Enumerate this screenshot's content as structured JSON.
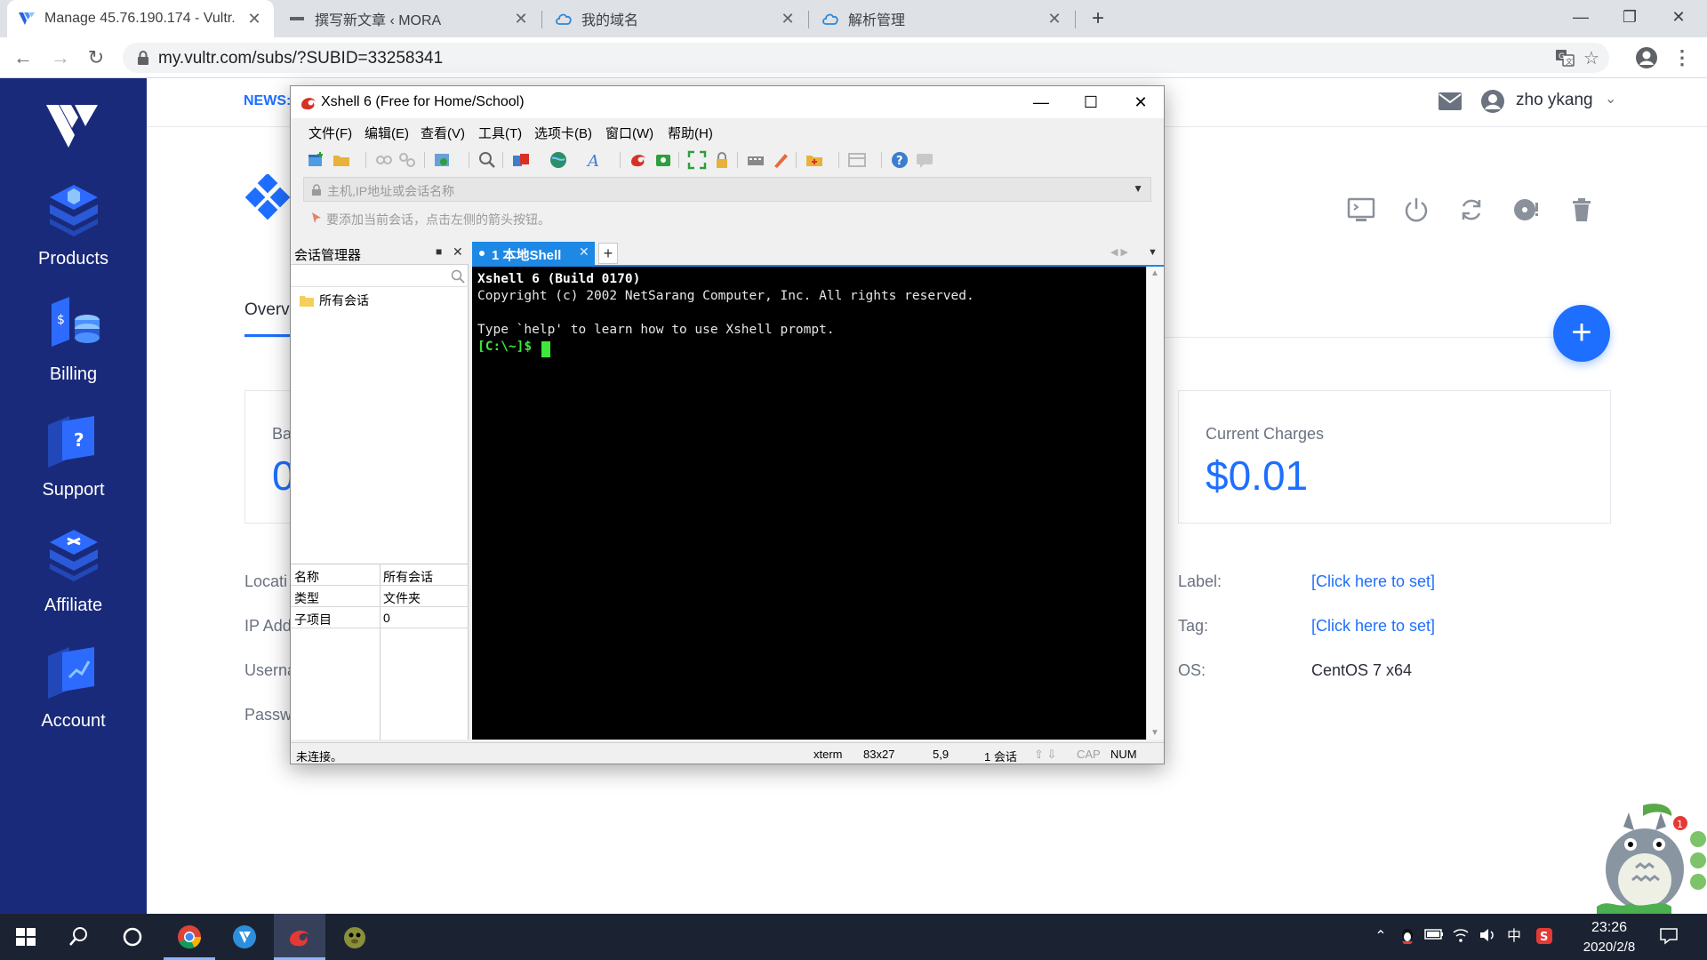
{
  "browser": {
    "tabs": [
      {
        "title": "Manage 45.76.190.174 - Vultr.",
        "active": true
      },
      {
        "title": "撰写新文章 ‹ MORA",
        "active": false
      },
      {
        "title": "我的域名",
        "active": false
      },
      {
        "title": "解析管理",
        "active": false
      }
    ],
    "url": "my.vultr.com/subs/?SUBID=33258341"
  },
  "sidebar": {
    "items": [
      {
        "label": "Products",
        "icon": "products-icon"
      },
      {
        "label": "Billing",
        "icon": "billing-icon"
      },
      {
        "label": "Support",
        "icon": "support-icon"
      },
      {
        "label": "Affiliate",
        "icon": "affiliate-icon"
      },
      {
        "label": "Account",
        "icon": "account-icon"
      }
    ]
  },
  "vultr": {
    "news_label": "NEWS:",
    "username": "zho ykang",
    "tab_overview": "Overvi",
    "cards": [
      {
        "title": "Ba",
        "value": "0"
      },
      {
        "title": "Current Charges",
        "value": "$0.01"
      }
    ],
    "left_info_labels": [
      "Locati",
      "IP Add",
      "Userna",
      "Passw"
    ],
    "right_info": [
      {
        "label": "Label:",
        "value": "[Click here to set]",
        "link": true
      },
      {
        "label": "Tag:",
        "value": "[Click here to set]",
        "link": true
      },
      {
        "label": "OS:",
        "value": "CentOS 7 x64",
        "link": false
      }
    ],
    "colors": {
      "sidebar": "#1a2a7a",
      "accent": "#1e6fff"
    }
  },
  "xshell": {
    "title": "Xshell 6 (Free for Home/School)",
    "menu": [
      "文件(F)",
      "编辑(E)",
      "查看(V)",
      "工具(T)",
      "选项卡(B)",
      "窗口(W)",
      "帮助(H)"
    ],
    "address_placeholder": "主机,IP地址或会话名称",
    "hint": "要添加当前会话，点击左侧的箭头按钮。",
    "session_manager": {
      "title": "会话管理器",
      "tree_item": "所有会话",
      "props": [
        {
          "key": "名称",
          "value": "所有会话"
        },
        {
          "key": "类型",
          "value": "文件夹"
        },
        {
          "key": "子项目",
          "value": "0"
        }
      ]
    },
    "terminal_tab": "1 本地Shell",
    "terminal_lines": [
      "Xshell 6 (Build 0170)",
      "Copyright (c) 2002 NetSarang Computer, Inc. All rights reserved.",
      "Type `help' to learn how to use Xshell prompt."
    ],
    "prompt": "[C:\\~]$ ",
    "status": {
      "connection": "未连接。",
      "term": "xterm",
      "size": "83x27",
      "pos": "5,9",
      "sessions": "1 会话",
      "cap": "CAP",
      "num": "NUM"
    }
  },
  "taskbar": {
    "time": "23:26",
    "date": "2020/2/8",
    "ime": "中"
  }
}
